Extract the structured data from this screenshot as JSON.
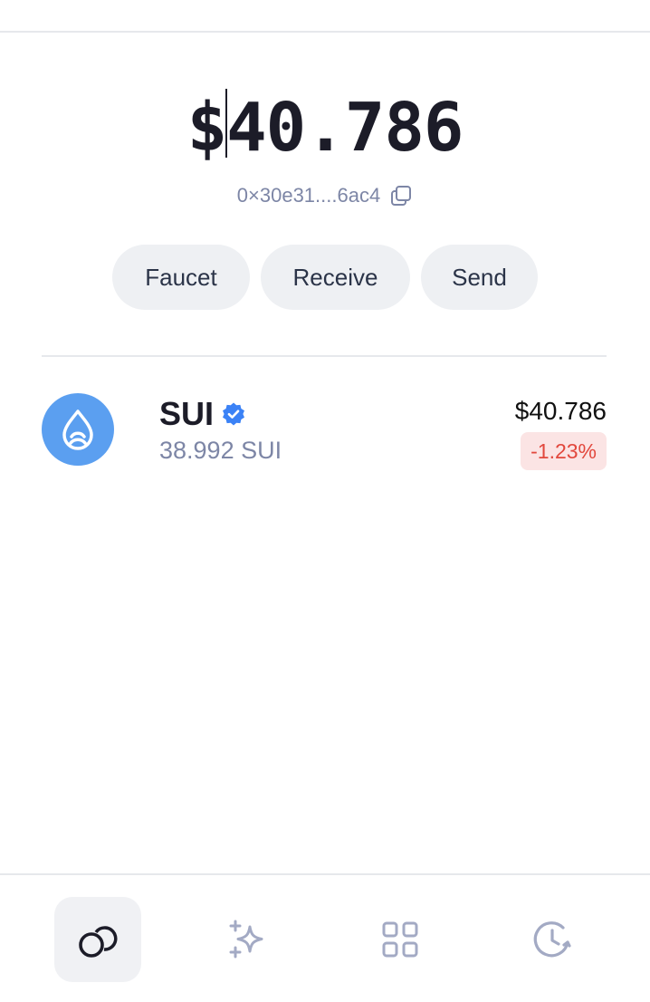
{
  "wallet": {
    "balance_prefix": "$",
    "balance_value": "40.786",
    "address_short": "0×30e31....6ac4"
  },
  "actions": {
    "faucet_label": "Faucet",
    "receive_label": "Receive",
    "send_label": "Send"
  },
  "tokens": [
    {
      "symbol": "SUI",
      "verified": true,
      "amount": "38.992 SUI",
      "value_usd": "$40.786",
      "change": "-1.23%",
      "logo_icon": "sui-droplet-icon"
    }
  ],
  "nav": {
    "items": [
      {
        "icon": "coins-icon",
        "active": true
      },
      {
        "icon": "sparkles-icon",
        "active": false
      },
      {
        "icon": "apps-grid-icon",
        "active": false
      },
      {
        "icon": "history-clock-icon",
        "active": false
      }
    ]
  },
  "colors": {
    "accent": "#5b9ff0",
    "text_primary": "#1c1c28",
    "text_muted": "#7d86a6",
    "pill_bg": "#eef0f3",
    "negative": "#e2483d",
    "negative_bg": "#fbe4e4",
    "verified": "#3b82f6",
    "nav_inactive": "#a3aac4"
  }
}
